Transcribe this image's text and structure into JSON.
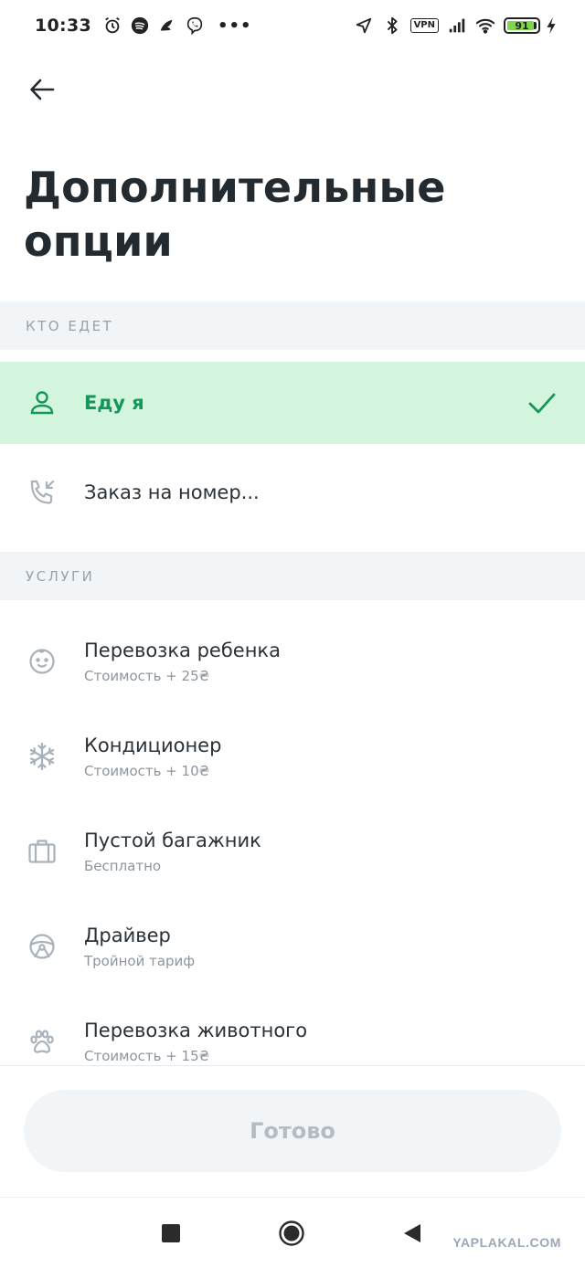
{
  "status_bar": {
    "time": "10:33",
    "vpn": "VPN",
    "battery": 91
  },
  "header": {
    "title": "Дополнительные опции"
  },
  "who_section": {
    "header": "КТО ЕДЕТ",
    "options": [
      {
        "label": "Еду я",
        "icon": "person-icon",
        "selected": true
      },
      {
        "label": "Заказ на номер...",
        "icon": "phone-incoming-icon",
        "selected": false
      }
    ]
  },
  "services_section": {
    "header": "УСЛУГИ",
    "items": [
      {
        "title": "Перевозка ребенка",
        "subtitle": "Стоимость + 25₴",
        "icon": "child-face-icon"
      },
      {
        "title": "Кондиционер",
        "subtitle": "Стоимость + 10₴",
        "icon": "snowflake-icon"
      },
      {
        "title": "Пустой багажник",
        "subtitle": "Бесплатно",
        "icon": "suitcase-icon"
      },
      {
        "title": "Драйвер",
        "subtitle": "Тройной тариф",
        "icon": "steering-wheel-icon"
      },
      {
        "title": "Перевозка животного",
        "subtitle": "Стоимость + 15₴",
        "icon": "paw-icon"
      }
    ]
  },
  "footer": {
    "done_label": "Готово"
  },
  "watermark": "YAPLAKAL.COM",
  "colors": {
    "accent": "#16965a",
    "selected_bg": "#d3f5dd",
    "section_bg": "#f2f5f8",
    "icon_gray": "#a9b2ba"
  }
}
